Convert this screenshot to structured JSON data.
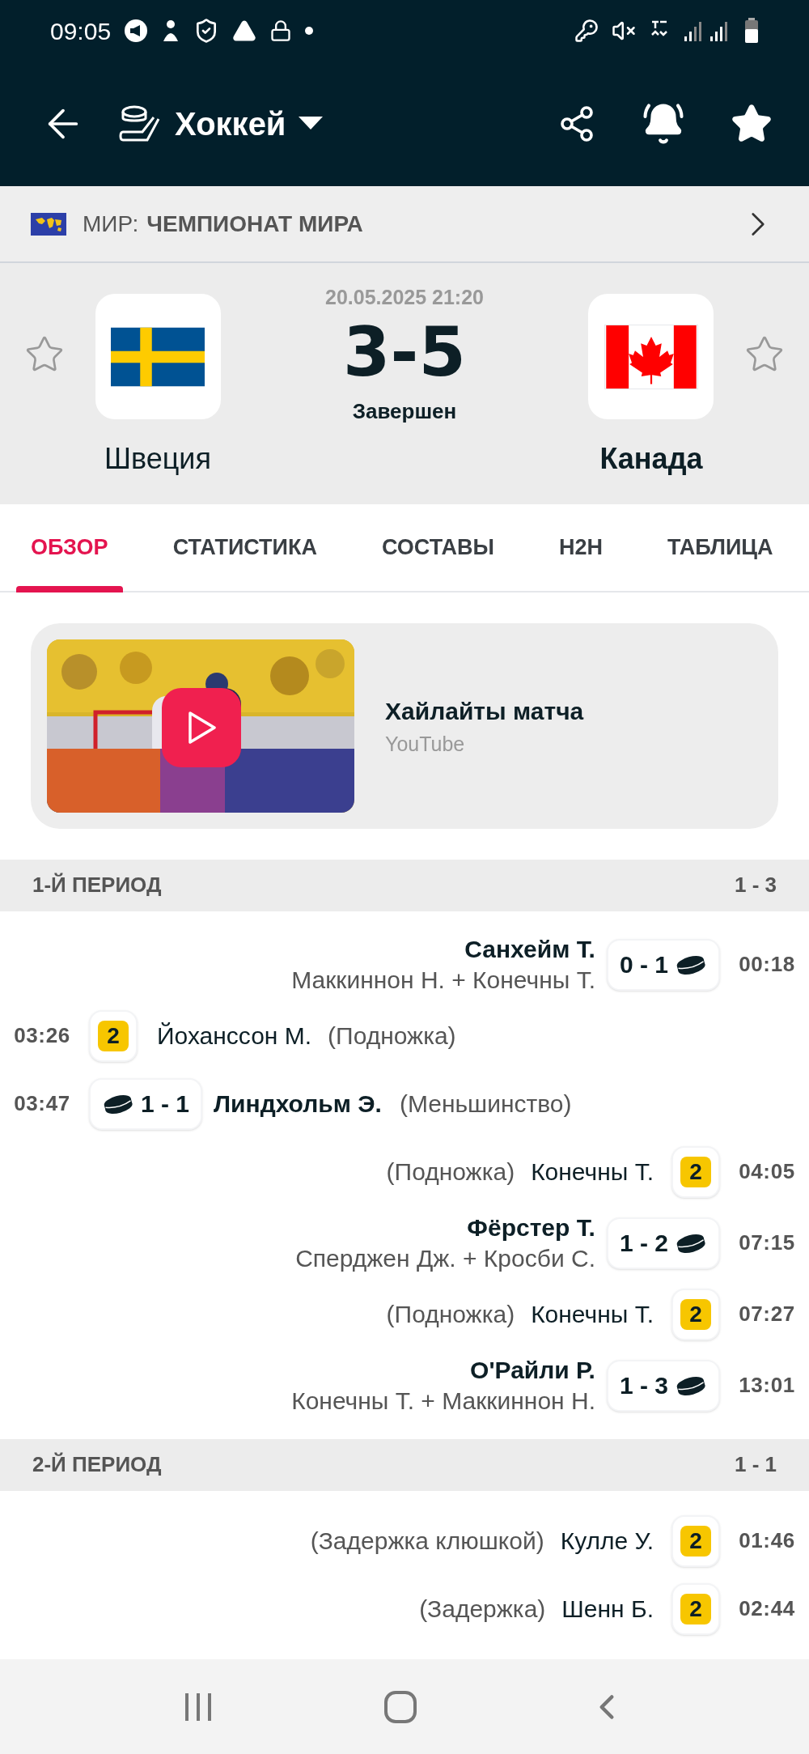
{
  "status_bar": {
    "time": "09:05"
  },
  "app_bar": {
    "sport": "Хоккей"
  },
  "league": {
    "country": "МИР:",
    "name": "ЧЕМПИОНАТ МИРА"
  },
  "match": {
    "date": "20.05.2025 21:20",
    "score": "3-5",
    "status": "Завершен",
    "home": {
      "name": "Швеция",
      "kind": "sweden",
      "favorite": false,
      "winner": false
    },
    "away": {
      "name": "Канада",
      "kind": "canada",
      "favorite": false,
      "winner": true
    }
  },
  "tabs": [
    {
      "label": "ОБЗОР",
      "selected": true
    },
    {
      "label": "СТАТИСТИКА",
      "selected": false
    },
    {
      "label": "СОСТАВЫ",
      "selected": false
    },
    {
      "label": "H2H",
      "selected": false
    },
    {
      "label": "ТАБЛИЦА",
      "selected": false
    }
  ],
  "highlights": {
    "title": "Хайлайты матча",
    "source": "YouTube"
  },
  "periods": [
    {
      "title": "1-Й ПЕРИОД",
      "score": "1 - 3",
      "events": [
        {
          "kind": "away_goal",
          "time": "00:18",
          "score": "0 - 1",
          "player": "Санхейм Т.",
          "assists": "Маккиннон Н. + Конечны Т."
        },
        {
          "kind": "home_penalty",
          "time": "03:26",
          "minutes": "2",
          "player": "Йоханссон М.",
          "reason": "(Подножка)"
        },
        {
          "kind": "home_goal",
          "time": "03:47",
          "score": "1 - 1",
          "player": "Линдхольм Э.",
          "reason": "(Меньшинство)"
        },
        {
          "kind": "away_penalty",
          "time": "04:05",
          "minutes": "2",
          "player": "Конечны Т.",
          "reason": "(Подножка)"
        },
        {
          "kind": "away_goal",
          "time": "07:15",
          "score": "1 - 2",
          "player": "Фёрстер Т.",
          "assists": "Сперджен Дж. + Кросби С."
        },
        {
          "kind": "away_penalty",
          "time": "07:27",
          "minutes": "2",
          "player": "Конечны Т.",
          "reason": "(Подножка)"
        },
        {
          "kind": "away_goal",
          "time": "13:01",
          "score": "1 - 3",
          "player": "О'Райли Р.",
          "assists": "Конечны Т. + Маккиннон Н."
        }
      ]
    },
    {
      "title": "2-Й ПЕРИОД",
      "score": "1 - 1",
      "events": [
        {
          "kind": "away_penalty",
          "time": "01:46",
          "minutes": "2",
          "player": "Кулле У.",
          "reason": "(Задержка клюшкой)"
        },
        {
          "kind": "away_penalty",
          "time": "02:44",
          "minutes": "2",
          "player": "Шенн Б.",
          "reason": "(Задержка)"
        }
      ]
    }
  ]
}
